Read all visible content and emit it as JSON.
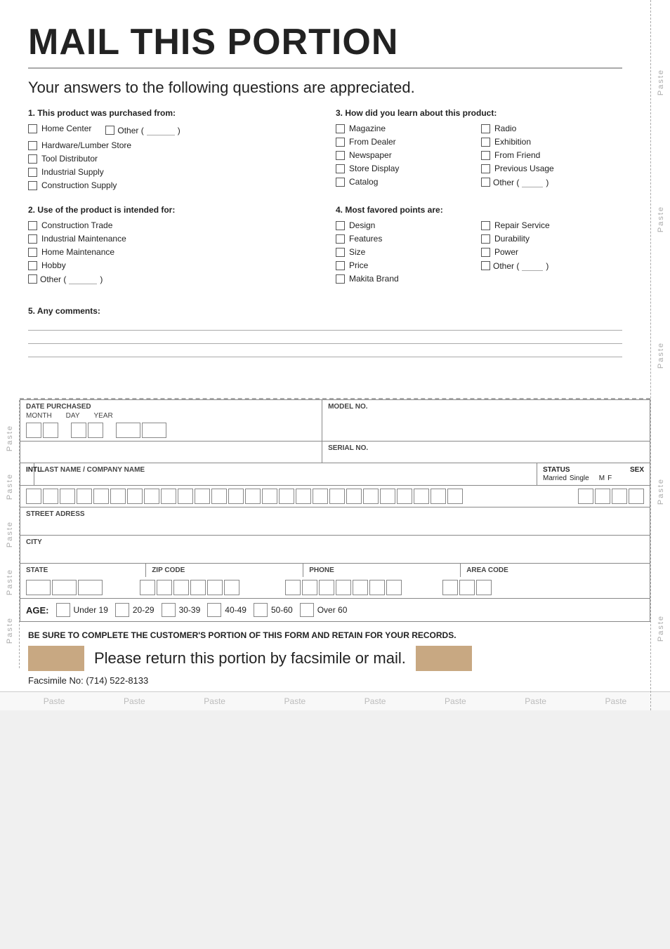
{
  "header": {
    "title": "MAIL THIS PORTION",
    "subtitle": "Your answers to the following questions are appreciated."
  },
  "q1": {
    "title": "1. This product was purchased from:",
    "items": [
      "Home Center",
      "Hardware/Lumber Store",
      "Tool Distributor",
      "Industrial Supply",
      "Construction Supply"
    ],
    "other_label": "Other (",
    "other_close": ")"
  },
  "q2": {
    "title": "2. Use of the product is intended for:",
    "items": [
      "Construction Trade",
      "Industrial Maintenance",
      "Home Maintenance",
      "Hobby"
    ],
    "other_label": "Other (",
    "other_close": ")"
  },
  "q3": {
    "title": "3. How did you learn about this product:",
    "col1": [
      "Magazine",
      "From Dealer",
      "Newspaper",
      "Store Display",
      "Catalog"
    ],
    "col2": [
      "Radio",
      "Exhibition",
      "From Friend",
      "Previous Usage"
    ],
    "other_label": "Other (",
    "other_close": ")"
  },
  "q4": {
    "title": "4. Most favored points are:",
    "col1": [
      "Design",
      "Features",
      "Size",
      "Price",
      "Makita Brand"
    ],
    "col2": [
      "Repair Service",
      "Durability",
      "Power"
    ],
    "other_label": "Other (",
    "other_close": ")"
  },
  "q5": {
    "title": "5. Any comments:"
  },
  "form": {
    "date_purchased": "DATE PURCHASED",
    "month": "MONTH",
    "day": "DAY",
    "year": "YEAR",
    "model_no": "MODEL NO.",
    "serial_no": "SERIAL NO.",
    "intl": "INTL.",
    "last_name_label": "LAST NAME / COMPANY NAME",
    "status": "STATUS",
    "married": "Married",
    "single": "Single",
    "sex": "SEX",
    "m": "M",
    "f": "F",
    "street": "STREET ADRESS",
    "city": "CITY",
    "state": "STATE",
    "zip": "ZIP CODE",
    "phone": "PHONE",
    "area_code": "AREA CODE",
    "age_label": "AGE:",
    "age_options": [
      "Under 19",
      "20-29",
      "30-39",
      "40-49",
      "50-60",
      "Over 60"
    ]
  },
  "notices": {
    "retain": "BE SURE TO COMPLETE THE CUSTOMER'S PORTION OF THIS FORM AND RETAIN FOR YOUR RECORDS.",
    "return_text": "Please return this portion by facsimile or mail.",
    "fax_label": "Facsimile No: (714) 522-8133"
  },
  "paste_labels": [
    "Paste",
    "Paste",
    "Paste",
    "Paste",
    "Paste",
    "Paste",
    "Paste",
    "Paste"
  ],
  "side_pastes": [
    "Paste",
    "Paste",
    "Paste",
    "Paste",
    "Paste"
  ]
}
